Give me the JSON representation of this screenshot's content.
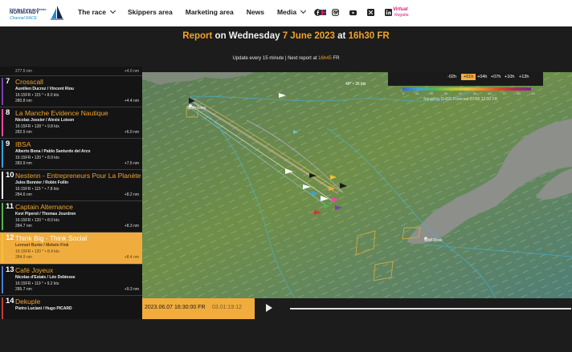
{
  "brand": {
    "top": "Défi des Ports de Pêche",
    "name": "NORMANDY",
    "sub": "Channel RACE"
  },
  "nav": {
    "items": [
      {
        "label": "The race",
        "dropdown": true
      },
      {
        "label": "Skippers area",
        "dropdown": false
      },
      {
        "label": "Marketing area",
        "dropdown": false
      },
      {
        "label": "News",
        "dropdown": false
      },
      {
        "label": "Media",
        "dropdown": true
      }
    ],
    "language_icon": "uk-flag-icon",
    "socials": [
      "facebook-icon",
      "instagram-icon",
      "youtube-icon",
      "x-twitter-icon",
      "linkedin-icon"
    ],
    "partner": {
      "line1": "Virtual",
      "line2": "Regatta"
    }
  },
  "report": {
    "prefix": "Report",
    "on": "on Wednesday",
    "date": "7 June 2023",
    "at": "at",
    "time": "16h30 FR",
    "update_text": "Update every 15 minute | Next report at",
    "next_time": "16h45",
    "next_tz": "FR"
  },
  "leaderboard": {
    "top_partial": {
      "dist": "277.5 nm",
      "gap": "+4.0 nm"
    },
    "rows": [
      {
        "rank": "7",
        "name": "Crosscall",
        "skippers": "Aurélien Ducroz / Vincent Riou",
        "info": "16:15FR • 115 ° • 8.0 kts",
        "dist": "280.8 nm",
        "gap": "+4.4 nm",
        "color": "#f0a32c",
        "highlight": false
      },
      {
        "rank": "8",
        "name": "La Manche Evidence Nautique",
        "skippers": "Nicolas Jossier / Alexis Loison",
        "info": "16:15FR • 128 ° • 9.8 kts",
        "dist": "282.5 nm",
        "gap": "+6.0 nm",
        "color": "#f0a32c",
        "highlight": false
      },
      {
        "rank": "9",
        "name": "IBSA",
        "skippers": "Alberto Bona / Pablo Santurde del Arco",
        "info": "16:15FR • 120 ° • 8.9 kts",
        "dist": "283.9 nm",
        "gap": "+7.5 nm",
        "color": "#f0a32c",
        "highlight": false
      },
      {
        "rank": "10",
        "name": "Nestenn - Entrepreneurs Pour La Planète",
        "skippers": "Jules Bonnier / Robin Follin",
        "info": "16:15FR • 115 ° • 7.8 kts",
        "dist": "284.6 nm",
        "gap": "+8.2 nm",
        "color": "#f0a32c",
        "highlight": false
      },
      {
        "rank": "11",
        "name": "Captain Alternance",
        "skippers": "Kevi Piperol / Thomas Jourdren",
        "info": "16:15FR • 120 ° • 8.0 kts",
        "dist": "284.7 nm",
        "gap": "+8.3 nm",
        "color": "#f0a32c",
        "highlight": false
      },
      {
        "rank": "12",
        "name": "Think Big - Think Social",
        "skippers": "Lennart Burke / Melwin Fink",
        "info": "16:15FR • 120 ° • 8.4 kts",
        "dist": "284.9 nm",
        "gap": "+8.4 nm",
        "color": "#f0a32c",
        "highlight": true
      },
      {
        "rank": "13",
        "name": "Café Joyeux",
        "skippers": "Nicolas d'Estais / Léo Debiesse",
        "info": "16:15FR • 119 ° • 9.2 kts",
        "dist": "285.7 nm",
        "gap": "+9.3 nm",
        "color": "#f0a32c",
        "highlight": false
      },
      {
        "rank": "14",
        "name": "Dekuple",
        "skippers": "Pietro Luciani / Hugo PICARD",
        "info": "",
        "dist": "",
        "gap": "",
        "color": "#f0a32c",
        "highlight": false
      }
    ],
    "bar_colors": [
      "#7a3fb0",
      "#e94aa0",
      "#39a0e0",
      "#ffffff",
      "#54b648",
      "#f0c238",
      "#4a7bd8",
      "#c83a3a"
    ]
  },
  "map": {
    "label_islands": "Scilly Isles",
    "label_wolf": "Wolf Rock",
    "coords": "49° • 36 kts",
    "time_buttons": [
      "-02h",
      "+01h",
      "+04h",
      "+07h",
      "+10h",
      "+13h"
    ],
    "time_active": "+01h",
    "legend_values": [
      "0",
      "10",
      "20",
      "30",
      "40",
      "50",
      "60",
      "70",
      "80",
      "90"
    ],
    "legend_source": "Squall by D-ICE   Forecast 07/06 12:00 FR"
  },
  "timeline": {
    "datetime": "2023.06.07 16:30:00 FR",
    "elapsed": "03.01:19:12",
    "play_icon": "play-icon"
  }
}
